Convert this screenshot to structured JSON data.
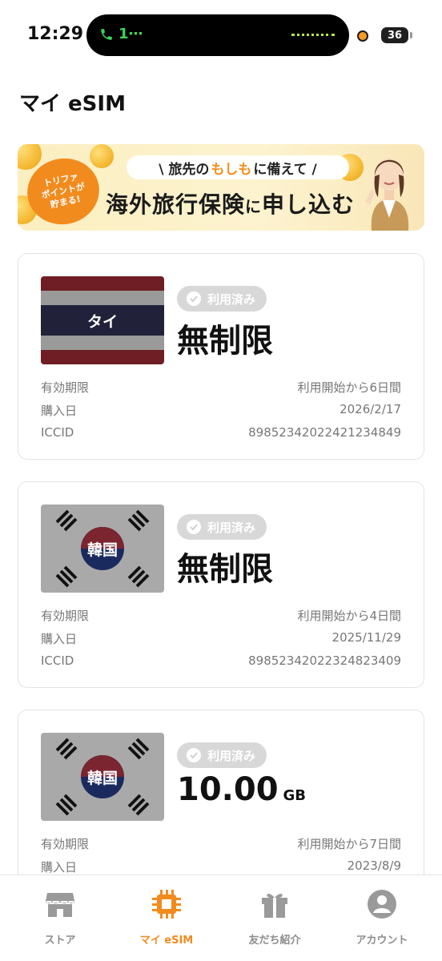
{
  "status_bar": {
    "time": "12:29",
    "call_indicator": "1⋯",
    "battery": "36"
  },
  "page": {
    "title": "マイ eSIM"
  },
  "banner": {
    "badge_lines": [
      "トリファ",
      "ポイントが",
      "貯まる!"
    ],
    "pill_prefix": "\\ 旅先の",
    "pill_highlight": "もしも",
    "pill_suffix": "に備えて /",
    "headline_a": "海外旅行保険",
    "headline_b": "に",
    "headline_c": "申し込む"
  },
  "cards": [
    {
      "country": "タイ",
      "flag": "thailand-flag",
      "status": "利用済み",
      "plan": "無制限",
      "unit": "",
      "rows": [
        {
          "label": "有効期限",
          "value": "利用開始から6日間"
        },
        {
          "label": "購入日",
          "value": "2026/2/17"
        },
        {
          "label": "ICCID",
          "value": "89852342022421234849"
        }
      ]
    },
    {
      "country": "韓国",
      "flag": "korea-flag",
      "status": "利用済み",
      "plan": "無制限",
      "unit": "",
      "rows": [
        {
          "label": "有効期限",
          "value": "利用開始から4日間"
        },
        {
          "label": "購入日",
          "value": "2025/11/29"
        },
        {
          "label": "ICCID",
          "value": "89852342022324823409"
        }
      ]
    },
    {
      "country": "韓国",
      "flag": "korea-flag",
      "status": "利用済み",
      "plan": "10.00",
      "unit": "GB",
      "rows": [
        {
          "label": "有効期限",
          "value": "利用開始から7日間"
        },
        {
          "label": "購入日",
          "value": "2023/8/9"
        }
      ]
    }
  ],
  "tabs": [
    {
      "label": "ストア",
      "icon": "store-icon",
      "active": false
    },
    {
      "label": "マイ eSIM",
      "icon": "chip-icon",
      "active": true
    },
    {
      "label": "友だち紹介",
      "icon": "gift-icon",
      "active": false
    },
    {
      "label": "アカウント",
      "icon": "account-icon",
      "active": false
    }
  ],
  "colors": {
    "accent": "#f28b1e",
    "inactive": "#8d8d8d",
    "status_pill": "#d8d8d8"
  }
}
